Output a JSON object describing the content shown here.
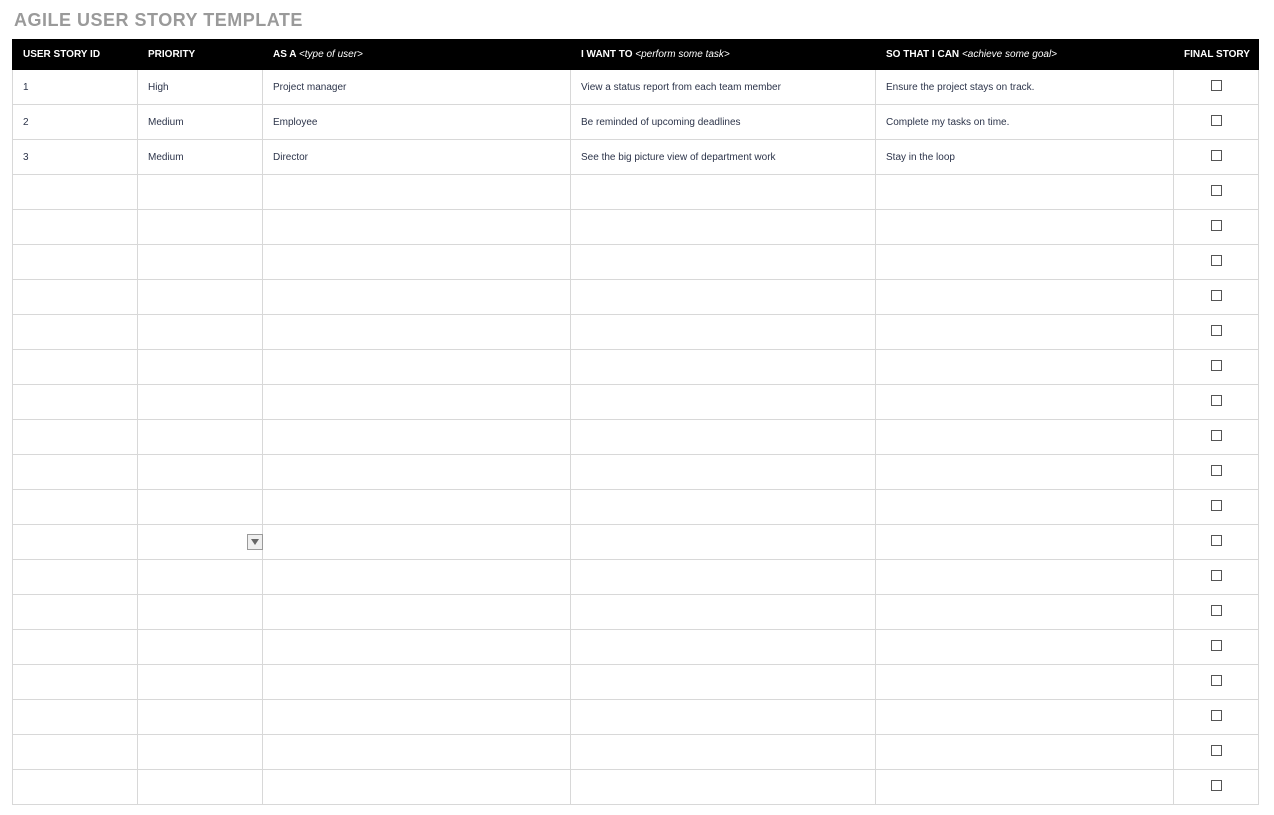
{
  "title": "AGILE USER STORY TEMPLATE",
  "columns": {
    "id": {
      "label": "USER STORY ID",
      "hint": ""
    },
    "prio": {
      "label": "PRIORITY",
      "hint": ""
    },
    "asa": {
      "label": "AS A ",
      "hint": "<type of user>"
    },
    "want": {
      "label": "I WANT TO ",
      "hint": "<perform some task>"
    },
    "sothat": {
      "label": "SO THAT I CAN ",
      "hint": "<achieve some goal>"
    },
    "final": {
      "label": "FINAL STORY",
      "hint": ""
    }
  },
  "rows": [
    {
      "id": "1",
      "priority": "High",
      "as_a": "Project manager",
      "i_want_to": "View a status report from each team member",
      "so_that": "Ensure the project stays on track.",
      "final": false,
      "show_dd": false
    },
    {
      "id": "2",
      "priority": "Medium",
      "as_a": "Employee",
      "i_want_to": "Be reminded of upcoming deadlines",
      "so_that": "Complete my tasks on time.",
      "final": false,
      "show_dd": false
    },
    {
      "id": "3",
      "priority": "Medium",
      "as_a": "Director",
      "i_want_to": "See the big picture view of department work",
      "so_that": "Stay in the loop",
      "final": false,
      "show_dd": false
    },
    {
      "id": "",
      "priority": "",
      "as_a": "",
      "i_want_to": "",
      "so_that": "",
      "final": false,
      "show_dd": false
    },
    {
      "id": "",
      "priority": "",
      "as_a": "",
      "i_want_to": "",
      "so_that": "",
      "final": false,
      "show_dd": false
    },
    {
      "id": "",
      "priority": "",
      "as_a": "",
      "i_want_to": "",
      "so_that": "",
      "final": false,
      "show_dd": false
    },
    {
      "id": "",
      "priority": "",
      "as_a": "",
      "i_want_to": "",
      "so_that": "",
      "final": false,
      "show_dd": false
    },
    {
      "id": "",
      "priority": "",
      "as_a": "",
      "i_want_to": "",
      "so_that": "",
      "final": false,
      "show_dd": false
    },
    {
      "id": "",
      "priority": "",
      "as_a": "",
      "i_want_to": "",
      "so_that": "",
      "final": false,
      "show_dd": false
    },
    {
      "id": "",
      "priority": "",
      "as_a": "",
      "i_want_to": "",
      "so_that": "",
      "final": false,
      "show_dd": false
    },
    {
      "id": "",
      "priority": "",
      "as_a": "",
      "i_want_to": "",
      "so_that": "",
      "final": false,
      "show_dd": false
    },
    {
      "id": "",
      "priority": "",
      "as_a": "",
      "i_want_to": "",
      "so_that": "",
      "final": false,
      "show_dd": false
    },
    {
      "id": "",
      "priority": "",
      "as_a": "",
      "i_want_to": "",
      "so_that": "",
      "final": false,
      "show_dd": false
    },
    {
      "id": "",
      "priority": "",
      "as_a": "",
      "i_want_to": "",
      "so_that": "",
      "final": false,
      "show_dd": true
    },
    {
      "id": "",
      "priority": "",
      "as_a": "",
      "i_want_to": "",
      "so_that": "",
      "final": false,
      "show_dd": false
    },
    {
      "id": "",
      "priority": "",
      "as_a": "",
      "i_want_to": "",
      "so_that": "",
      "final": false,
      "show_dd": false
    },
    {
      "id": "",
      "priority": "",
      "as_a": "",
      "i_want_to": "",
      "so_that": "",
      "final": false,
      "show_dd": false
    },
    {
      "id": "",
      "priority": "",
      "as_a": "",
      "i_want_to": "",
      "so_that": "",
      "final": false,
      "show_dd": false
    },
    {
      "id": "",
      "priority": "",
      "as_a": "",
      "i_want_to": "",
      "so_that": "",
      "final": false,
      "show_dd": false
    },
    {
      "id": "",
      "priority": "",
      "as_a": "",
      "i_want_to": "",
      "so_that": "",
      "final": false,
      "show_dd": false
    },
    {
      "id": "",
      "priority": "",
      "as_a": "",
      "i_want_to": "",
      "so_that": "",
      "final": false,
      "show_dd": false
    }
  ]
}
